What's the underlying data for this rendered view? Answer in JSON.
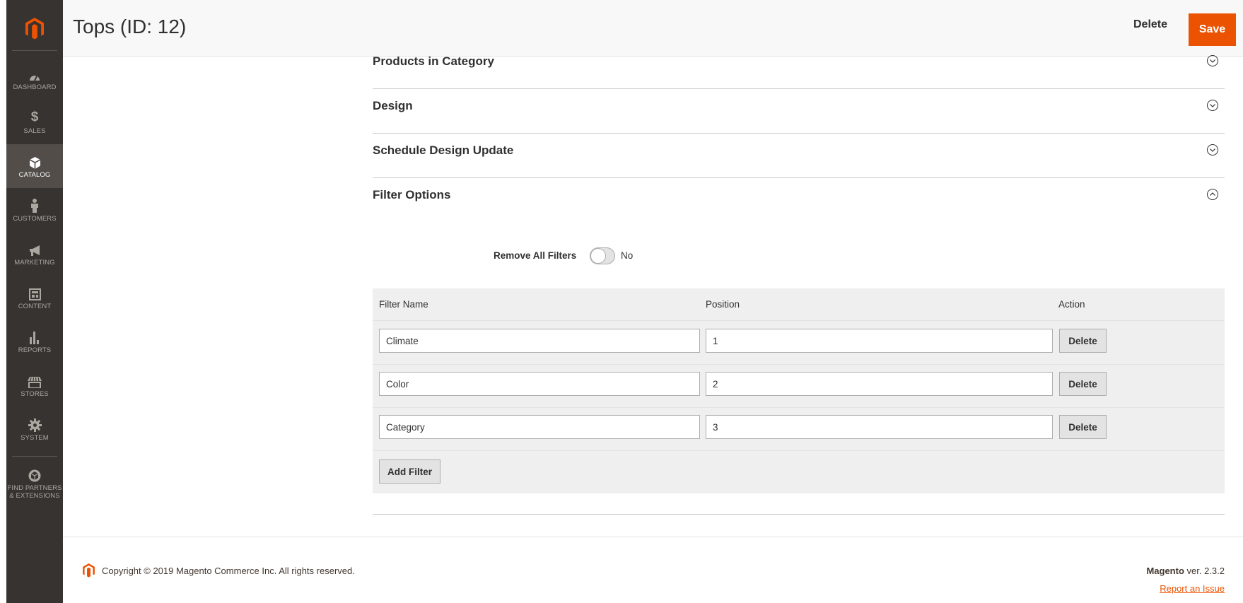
{
  "sidebar": {
    "logo_icon": "magento-logo-icon",
    "items": [
      {
        "label": "DASHBOARD",
        "icon": "dashboard-icon"
      },
      {
        "label": "$",
        "sub": "SALES",
        "icon": "dollar-icon"
      },
      {
        "label": "CATALOG",
        "icon": "cube-icon"
      },
      {
        "label": "CUSTOMERS",
        "icon": "person-icon"
      },
      {
        "label": "MARKETING",
        "icon": "megaphone-icon"
      },
      {
        "label": "CONTENT",
        "icon": "layout-icon"
      },
      {
        "label": "REPORTS",
        "icon": "bar-chart-icon"
      },
      {
        "label": "STORES",
        "icon": "storefront-icon"
      },
      {
        "label": "SYSTEM",
        "icon": "gear-icon"
      },
      {
        "label": "FIND PARTNERS",
        "label2": "& EXTENSIONS",
        "icon": "partners-box-icon"
      }
    ]
  },
  "header": {
    "title": "Tops (ID: 12)",
    "delete_label": "Delete",
    "save_label": "Save"
  },
  "sections": [
    {
      "title": "Products in Category",
      "state": "collapsed"
    },
    {
      "title": "Design",
      "state": "collapsed"
    },
    {
      "title": "Schedule Design Update",
      "state": "collapsed"
    },
    {
      "title": "Filter Options",
      "state": "expanded"
    }
  ],
  "filter_options": {
    "remove_all_label": "Remove All Filters",
    "remove_all_value": "No",
    "columns": {
      "name": "Filter Name",
      "position": "Position",
      "action": "Action"
    },
    "rows": [
      {
        "name": "Climate",
        "position": "1",
        "action": "Delete"
      },
      {
        "name": "Color",
        "position": "2",
        "action": "Delete"
      },
      {
        "name": "Category",
        "position": "3",
        "action": "Delete"
      }
    ],
    "add_label": "Add Filter"
  },
  "footer": {
    "copyright": "Copyright © 2019 Magento Commerce Inc. All rights reserved.",
    "brand": "Magento",
    "version": " ver. 2.3.2",
    "report_label": "Report an Issue"
  },
  "colors": {
    "accent": "#eb5202",
    "sidebar_bg": "#373330",
    "sidebar_active": "#524d49"
  }
}
